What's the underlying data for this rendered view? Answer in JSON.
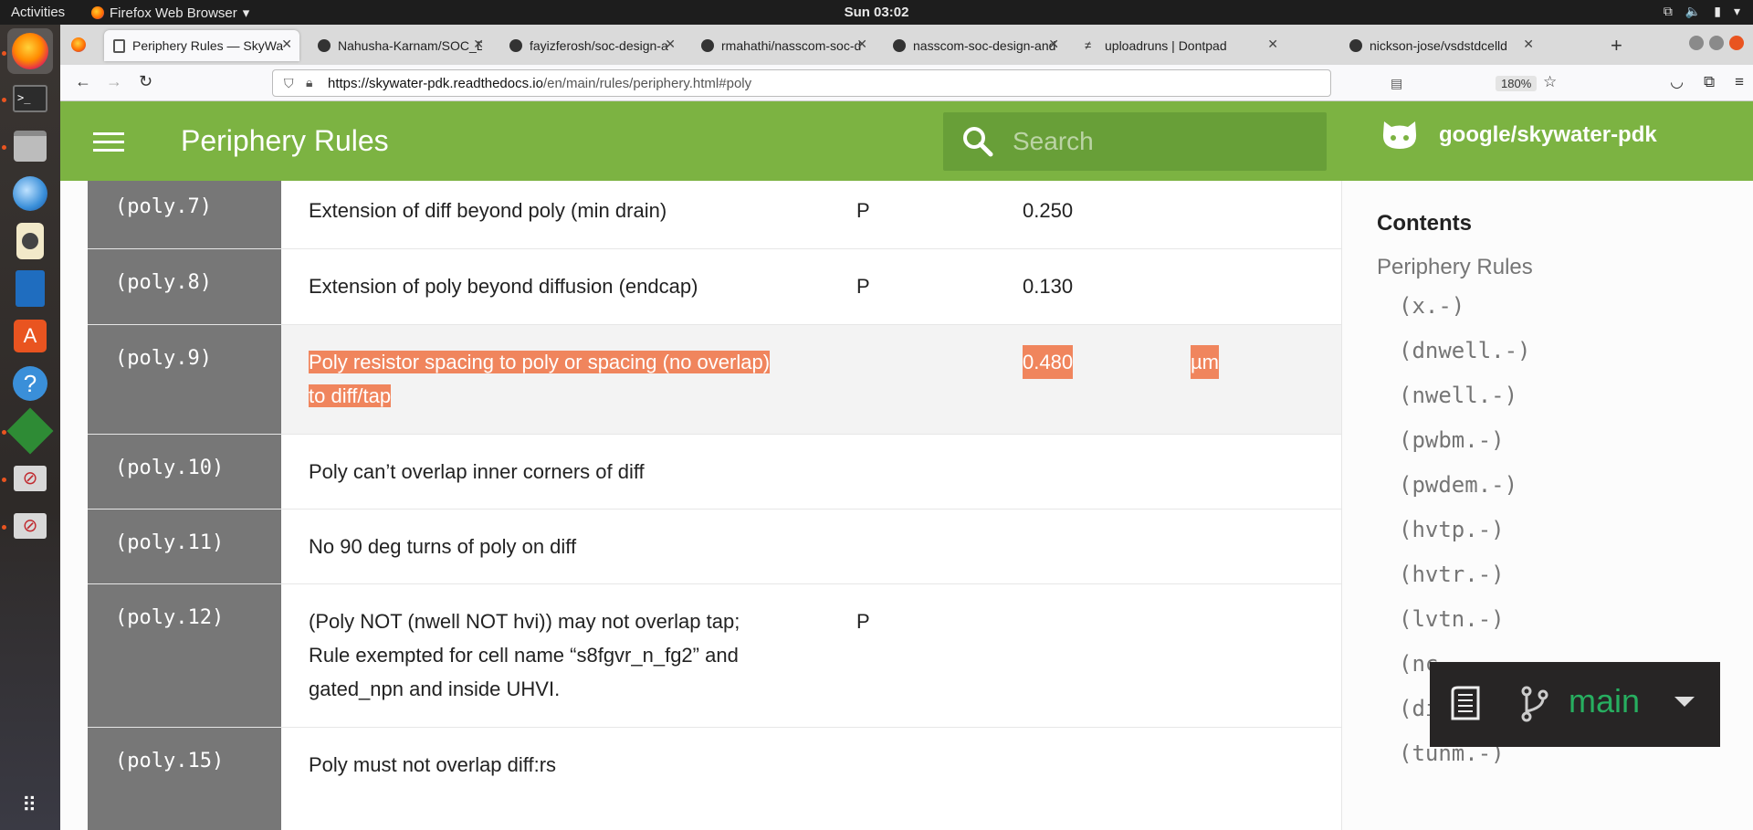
{
  "topbar": {
    "activities": "Activities",
    "app_name": "Firefox Web Browser",
    "clock": "Sun 03:02"
  },
  "browser": {
    "tabs": [
      {
        "label": "Periphery Rules — SkyWa",
        "active": true
      },
      {
        "label": "Nahusha-Karnam/SOC_D",
        "active": false
      },
      {
        "label": "fayizferosh/soc-design-a",
        "active": false
      },
      {
        "label": "rmahathi/nasscom-soc-d",
        "active": false
      },
      {
        "label": "nasscom-soc-design-and-",
        "active": false
      },
      {
        "label": "uploadruns | Dontpad",
        "active": false
      },
      {
        "label": "nickson-jose/vsdstdcelld",
        "active": false
      }
    ],
    "url_host": "https://skywater-pdk.readthedocs.io",
    "url_path": "/en/main/rules/periphery.html#poly",
    "zoom": "180%"
  },
  "header": {
    "title": "Periphery Rules",
    "search_placeholder": "Search",
    "repo": "google/skywater-pdk"
  },
  "rules": [
    {
      "code": "(poly.7)",
      "desc": "Extension of diff beyond poly (min drain)",
      "flag": "P",
      "value": "0.250",
      "unit": ""
    },
    {
      "code": "(poly.8)",
      "desc": "Extension of poly beyond diffusion (endcap)",
      "flag": "P",
      "value": "0.130",
      "unit": ""
    },
    {
      "code": "(poly.9)",
      "desc1": "Poly resistor spacing to poly or spacing (no overlap)",
      "desc2": "to diff/tap",
      "flag": "",
      "value": "0.480",
      "unit": "µm"
    },
    {
      "code": "(poly.10)",
      "desc": "Poly can’t overlap inner corners of diff",
      "flag": "",
      "value": "",
      "unit": ""
    },
    {
      "code": "(poly.11)",
      "desc": "No 90 deg turns of poly on diff",
      "flag": "",
      "value": "",
      "unit": ""
    },
    {
      "code": "(poly.12)",
      "desc": "(Poly NOT (nwell NOT hvi)) may not overlap tap; Rule exempted for cell name “s8fgvr_n_fg2” and gated_npn and inside UHVI.",
      "flag": "P",
      "value": "",
      "unit": ""
    },
    {
      "code": "(poly.15)",
      "desc": "Poly must not overlap diff:rs",
      "flag": "",
      "value": "",
      "unit": ""
    }
  ],
  "toc": {
    "heading": "Contents",
    "section": "Periphery Rules",
    "items": [
      "(x.-)",
      "(dnwell.-)",
      "(nwell.-)",
      "(pwbm.-)",
      "(pwdem.-)",
      "(hvtp.-)",
      "(hvtr.-)",
      "(lvtn.-)",
      "(nc",
      "(di",
      "(tunm.-)"
    ]
  },
  "flyout": {
    "version": "main"
  },
  "colors": {
    "header_green": "#7cb342",
    "search_green": "#689f38",
    "highlight": "#f0855d",
    "version_green": "#27ae60"
  }
}
